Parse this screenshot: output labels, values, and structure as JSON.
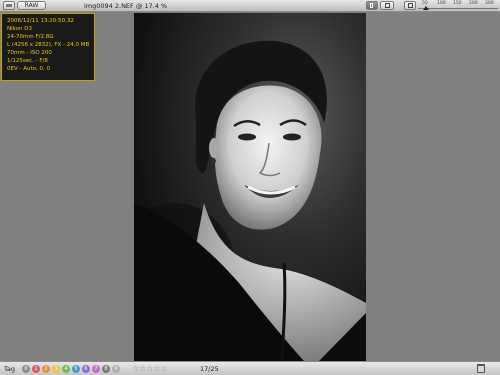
{
  "toolbar": {
    "raw_label": "RAW",
    "title": "img0094 2.NEF @ 17.4 %",
    "zoom_ticks": [
      "50",
      "100",
      "150",
      "200",
      "300"
    ]
  },
  "exif": {
    "datetime": "2008/12/11 13:20:50.32",
    "camera": "Nikon D3",
    "lens": "24-70mm F/2.8G",
    "dimensions": "L (4256 x 2832), FX - 24.0 MB",
    "focal_iso": "70mm - ISO 200",
    "shutter_aperture": "1/125sec. - F/8",
    "exposure": "0EV - Auto, 0, 0"
  },
  "bottombar": {
    "tag_label": "Tag",
    "tag_numbers": [
      "0",
      "1",
      "2",
      "3",
      "4",
      "5",
      "6",
      "7",
      "8",
      "9"
    ],
    "tag_colors": [
      "#8c8c8c",
      "#e05a5a",
      "#f08a3a",
      "#e8c83a",
      "#6cbf4e",
      "#3e9ed8",
      "#8a6fd0",
      "#c76bc8",
      "#7a7a7a",
      "#b0b0b0"
    ],
    "stars": "☆☆☆☆☆",
    "counter": "17/25"
  }
}
